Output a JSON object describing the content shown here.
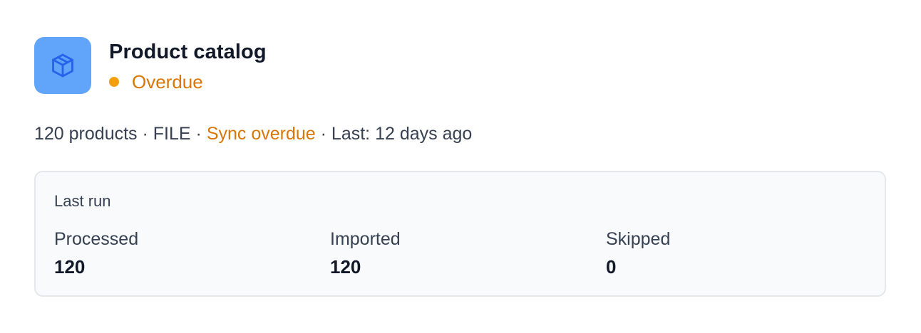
{
  "source": {
    "name": "Product catalog",
    "icon": "package-icon",
    "accent_color": "#60a5fa",
    "status": {
      "label": "Overdue",
      "color": "#f59e0b"
    }
  },
  "meta": {
    "products": "120 products",
    "type": "FILE",
    "sync_status": "Sync overdue",
    "last": "Last: 12 days ago",
    "separator": "·"
  },
  "last_run": {
    "label": "Last run",
    "stats": [
      {
        "label": "Processed",
        "value": "120"
      },
      {
        "label": "Imported",
        "value": "120"
      },
      {
        "label": "Skipped",
        "value": "0"
      }
    ]
  }
}
